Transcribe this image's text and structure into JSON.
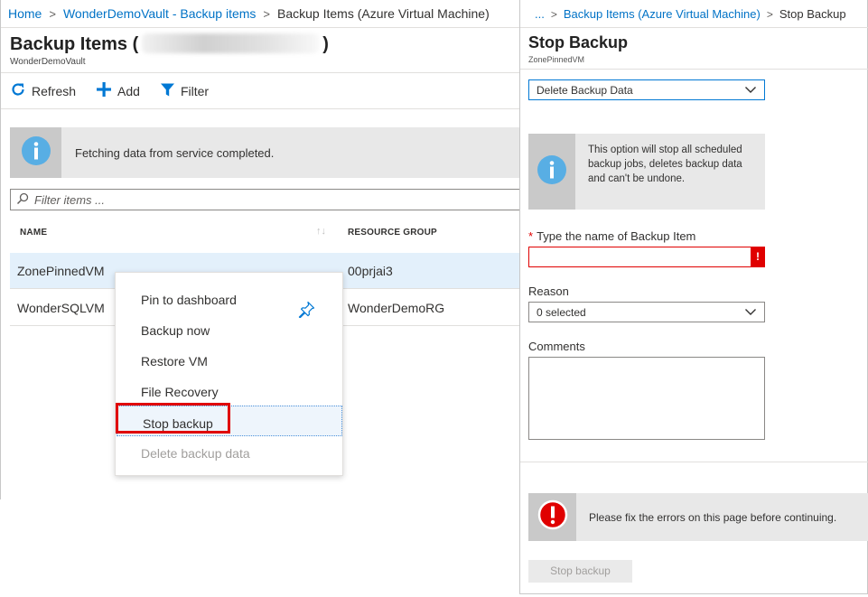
{
  "left": {
    "breadcrumb": [
      "Home",
      "WonderDemoVault - Backup items",
      "Backup Items (Azure Virtual Machine)"
    ],
    "title_prefix": "Backup Items (",
    "title_suffix": ")",
    "subtitle": "WonderDemoVault",
    "commands": {
      "refresh": "Refresh",
      "add": "Add",
      "filter": "Filter"
    },
    "info_message": "Fetching data from service completed.",
    "filter_placeholder": "Filter items ...",
    "columns": {
      "name": "NAME",
      "resource_group": "RESOURCE GROUP"
    },
    "rows": [
      {
        "name": "ZonePinnedVM",
        "resource_group": "00prjai3"
      },
      {
        "name": "WonderSQLVM",
        "resource_group": "WonderDemoRG"
      }
    ],
    "context_menu": [
      "Pin to dashboard",
      "Backup now",
      "Restore VM",
      "File Recovery",
      "Stop backup",
      "Delete backup data"
    ]
  },
  "right": {
    "breadcrumb_ellipsis": "...",
    "breadcrumb": [
      "Backup Items (Azure Virtual Machine)",
      "Stop Backup"
    ],
    "title": "Stop Backup",
    "subtitle": "ZonePinnedVM",
    "mode_select": "Delete Backup Data",
    "warning": "This option will stop all scheduled backup jobs, deletes backup data and can't be undone.",
    "name_label": "Type the name of Backup Item",
    "required_marker": "*",
    "error_flag": "!",
    "reason_label": "Reason",
    "reason_value": "0 selected",
    "comments_label": "Comments",
    "error_message": "Please fix the errors on this page before continuing.",
    "stop_button": "Stop backup"
  },
  "colors": {
    "link": "#0072c6",
    "info_icon": "#58aee4",
    "error": "#e00000",
    "pin_icon": "#0078d4"
  },
  "icons": [
    "refresh-icon",
    "add-icon",
    "filter-icon",
    "info-icon",
    "search-icon",
    "sort-icon",
    "pin-icon",
    "chevron-down-icon",
    "error-icon"
  ]
}
